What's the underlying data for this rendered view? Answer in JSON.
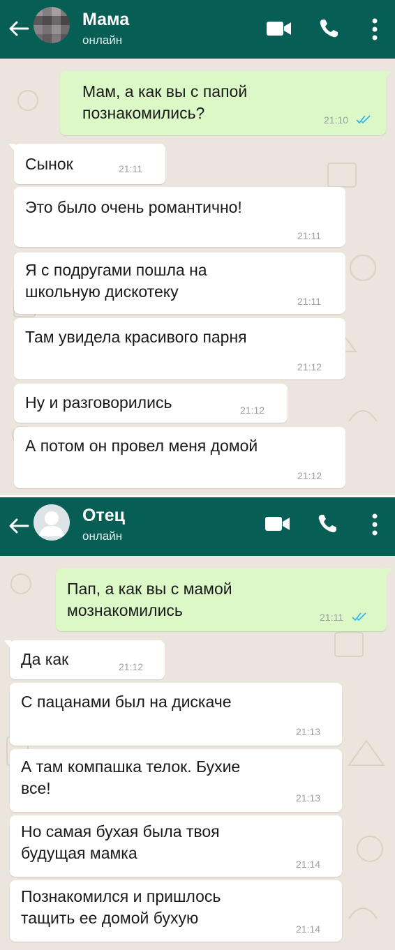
{
  "chats": [
    {
      "contact_name": "Мама",
      "status": "онлайн",
      "messages": [
        {
          "dir": "out",
          "text": "Мам, а как вы с папой\nпознакомились?",
          "time": "21:10",
          "read": true
        },
        {
          "dir": "in",
          "text": "Сынок",
          "time": "21:11"
        },
        {
          "dir": "in",
          "text": "Это было очень романтично!",
          "time": "21:11"
        },
        {
          "dir": "in",
          "text": "Я с подругами пошла на\nшкольную дискотеку",
          "time": "21:11"
        },
        {
          "dir": "in",
          "text": "Там увидела красивого парня",
          "time": "21:12"
        },
        {
          "dir": "in",
          "text": "Ну и разговорились",
          "time": "21:12"
        },
        {
          "dir": "in",
          "text": "А потом он провел меня домой",
          "time": "21:12"
        }
      ]
    },
    {
      "contact_name": "Отец",
      "status": "онлайн",
      "messages": [
        {
          "dir": "out",
          "text": "Пап, а как вы с мамой\nмознакомились",
          "time": "21:11",
          "read": true
        },
        {
          "dir": "in",
          "text": "Да как",
          "time": "21:12"
        },
        {
          "dir": "in",
          "text": "С пацанами был на дискаче",
          "time": "21:13"
        },
        {
          "dir": "in",
          "text": "А там компашка телок. Бухие\nвсе!",
          "time": "21:13"
        },
        {
          "dir": "in",
          "text": "Но самая бухая была твоя\nбудущая мамка",
          "time": "21:14"
        },
        {
          "dir": "in",
          "text": "Познакомился и пришлось\nтащить ее домой бухую",
          "time": "21:14"
        }
      ]
    }
  ],
  "icons": {
    "back": "arrow-left-icon",
    "video": "video-camera-icon",
    "call": "phone-icon",
    "menu": "more-vertical-icon"
  },
  "colors": {
    "header": "#075e54",
    "outgoing_bubble": "#dcf8c6",
    "incoming_bubble": "#ffffff",
    "chat_background": "#ece5dd",
    "read_ticks": "#34b7f1"
  }
}
